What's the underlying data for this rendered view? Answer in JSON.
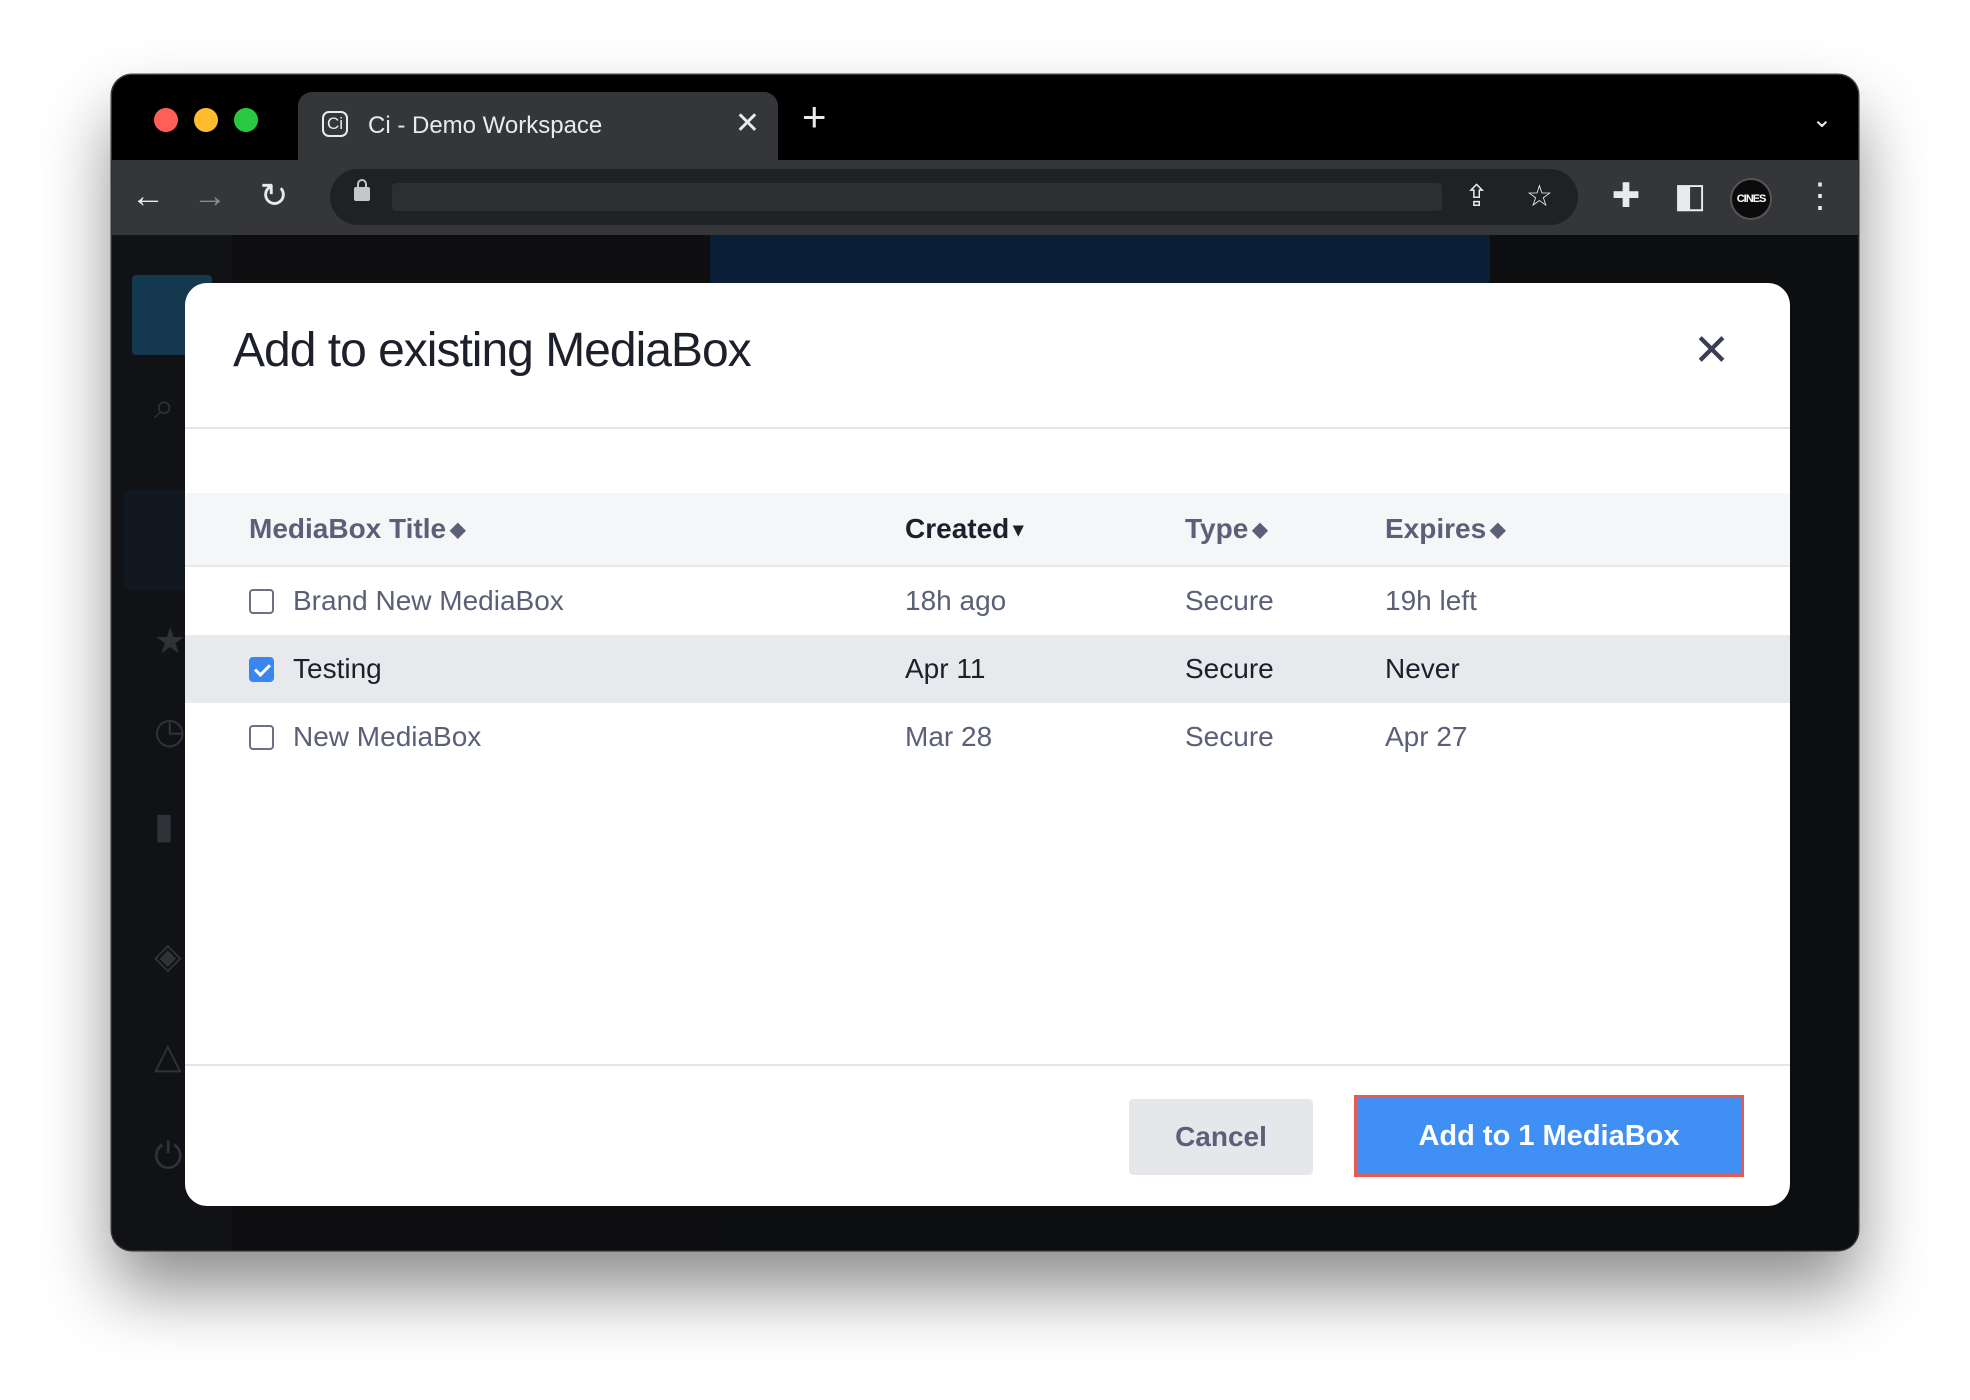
{
  "browser": {
    "tab_title": "Ci - Demo Workspace",
    "tab_favicon_letter": "Ci",
    "tab_close_glyph": "✕",
    "new_tab_glyph": "+",
    "tab_menu_glyph": "⌄",
    "back_glyph": "←",
    "forward_glyph": "→",
    "reload_glyph": "↻",
    "url": "",
    "share_glyph": "⇪",
    "bookmark_glyph": "☆",
    "extensions_glyph": "✚",
    "sidepanel_glyph": "◧",
    "profile_label": "CINES",
    "menu_glyph": "⋮"
  },
  "modal": {
    "title": "Add to existing MediaBox",
    "close_glyph": "✕",
    "columns": [
      {
        "label": "MediaBox Title",
        "sort": "◆"
      },
      {
        "label": "Created",
        "sort": "▾"
      },
      {
        "label": "Type",
        "sort": "◆"
      },
      {
        "label": "Expires",
        "sort": "◆"
      }
    ],
    "rows": [
      {
        "title": "Brand New MediaBox",
        "created": "18h ago",
        "type": "Secure",
        "expires": "19h left",
        "checked": false
      },
      {
        "title": "Testing",
        "created": "Apr 11",
        "type": "Secure",
        "expires": "Never",
        "checked": true
      },
      {
        "title": "New MediaBox",
        "created": "Mar 28",
        "type": "Secure",
        "expires": "Apr 27",
        "checked": false
      }
    ],
    "cancel_label": "Cancel",
    "primary_label": "Add to 1 MediaBox"
  },
  "colors": {
    "primary": "#3f8ff5",
    "highlight_outline": "#e45a52",
    "checkbox_on": "#3a86f0"
  }
}
